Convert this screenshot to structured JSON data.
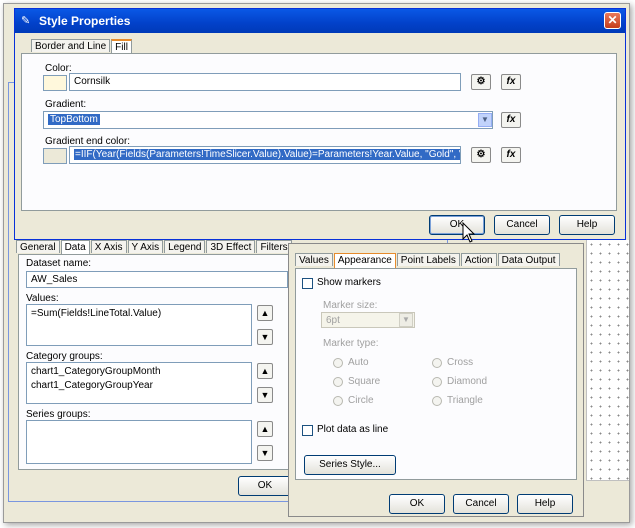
{
  "style_dialog": {
    "title": "Style Properties",
    "tabs": [
      "Border and Line",
      "Fill"
    ],
    "color_label": "Color:",
    "color_value": "Cornsilk",
    "gradient_label": "Gradient:",
    "gradient_value": "TopBottom",
    "gradient_end_label": "Gradient end color:",
    "gradient_end_value": "=IIF(Year(Fields(Parameters!TimeSlicer.Value).Value)=Parameters!Year.Value, \"Gold\", \"Blue\")",
    "fx_label": "fx",
    "ok": "OK",
    "cancel": "Cancel",
    "help": "Help",
    "color_swatch": "#fff8dc"
  },
  "chart_dialog": {
    "tabs": [
      "General",
      "Data",
      "X Axis",
      "Y Axis",
      "Legend",
      "3D Effect",
      "Filters"
    ],
    "dataset_label": "Dataset name:",
    "dataset_value": "AW_Sales",
    "values_label": "Values:",
    "values_items": [
      "=Sum(Fields!LineTotal.Value)"
    ],
    "category_label": "Category groups:",
    "category_items": [
      "chart1_CategoryGroupMonth",
      "chart1_CategoryGroupYear"
    ],
    "series_label": "Series groups:",
    "ok": "OK"
  },
  "series_dialog": {
    "tabs": [
      "Values",
      "Appearance",
      "Point Labels",
      "Action",
      "Data Output"
    ],
    "show_markers": "Show markers",
    "marker_size_label": "Marker size:",
    "marker_size_value": "6pt",
    "marker_type_label": "Marker type:",
    "marker_types": [
      "Auto",
      "Cross",
      "Square",
      "Diamond",
      "Circle",
      "Triangle"
    ],
    "plot_as_line": "Plot data as line",
    "series_style": "Series Style...",
    "ok": "OK",
    "cancel": "Cancel",
    "help": "Help"
  }
}
